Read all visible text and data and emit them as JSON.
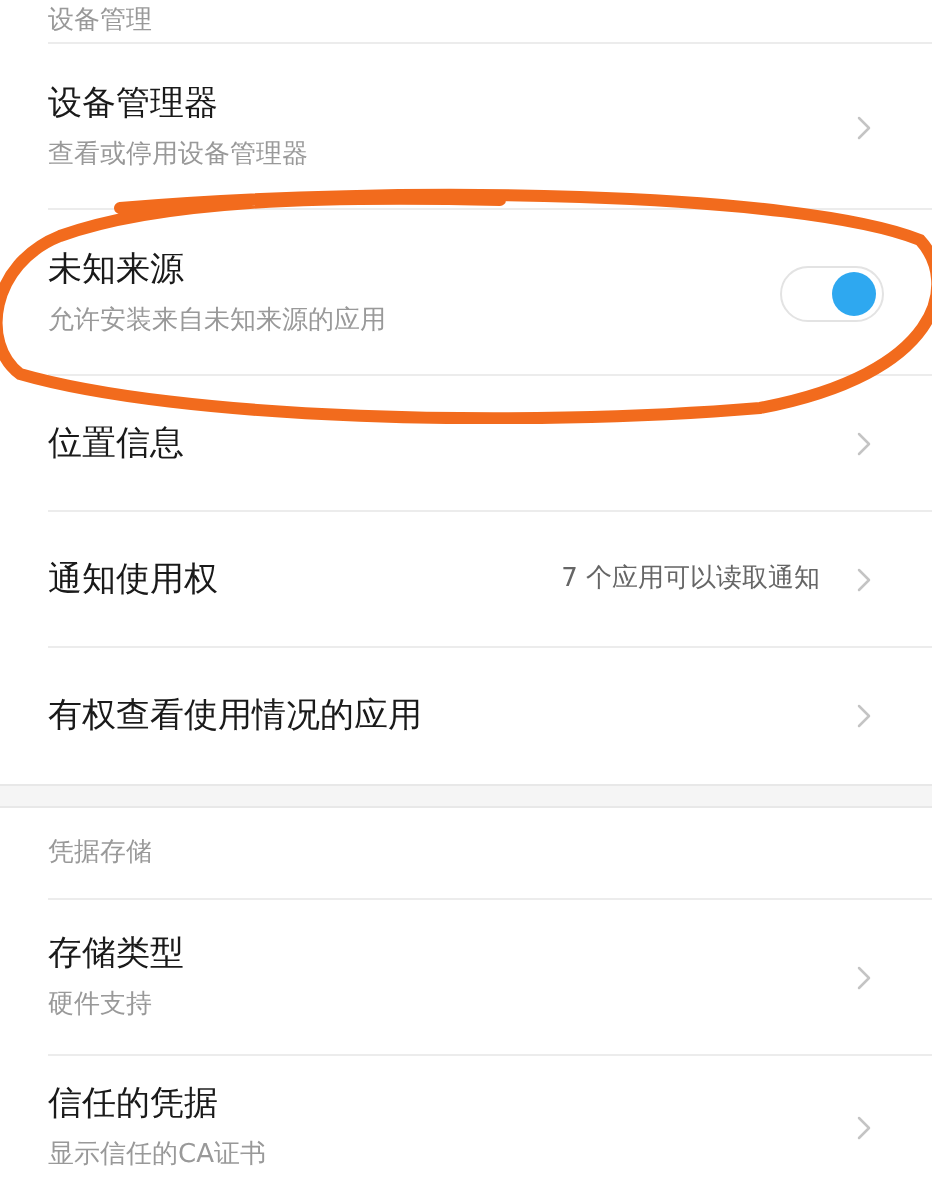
{
  "sections": [
    {
      "header": "设备管理",
      "items": [
        {
          "kind": "nav",
          "title": "设备管理器",
          "subtitle": "查看或停用设备管理器"
        },
        {
          "kind": "toggle",
          "title": "未知来源",
          "subtitle": "允许安装来自未知来源的应用",
          "on": true
        },
        {
          "kind": "nav",
          "title": "位置信息"
        },
        {
          "kind": "nav",
          "title": "通知使用权",
          "value": "7 个应用可以读取通知"
        },
        {
          "kind": "nav",
          "title": "有权查看使用情况的应用"
        }
      ]
    },
    {
      "header": "凭据存储",
      "items": [
        {
          "kind": "nav",
          "title": "存储类型",
          "subtitle": "硬件支持"
        },
        {
          "kind": "nav",
          "title": "信任的凭据",
          "subtitle": "显示信任的CA证书"
        }
      ]
    }
  ]
}
